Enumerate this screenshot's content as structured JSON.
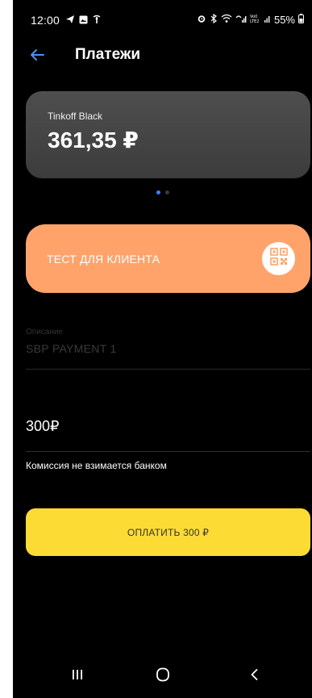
{
  "status_bar": {
    "time": "12:00",
    "battery": "55%",
    "icons": [
      "send-icon",
      "image-icon",
      "signal-relay-icon",
      "alarm-icon",
      "bluetooth-icon",
      "wifi-icon",
      "signal-icon",
      "volte-icon",
      "signal-icon",
      "battery-icon"
    ]
  },
  "header": {
    "title": "Платежи",
    "back_icon": "arrow-left-icon"
  },
  "account": {
    "name": "Tinkoff Black",
    "balance": "361,35 ₽",
    "page_count": 2,
    "active_page": 1
  },
  "recipient": {
    "name": "ТЕСТ ДЛЯ КЛИЕНТА",
    "qr_icon": "qr-code-icon"
  },
  "description": {
    "label": "Описание",
    "value": "SBP PAYMENT 1"
  },
  "amount": {
    "value": "300₽"
  },
  "commission_note": "Комиссия не взимается банком",
  "pay_button": {
    "label": "ОПЛАТИТЬ 300 ₽"
  },
  "nav": {
    "items": [
      "recent-apps-icon",
      "home-icon",
      "back-icon"
    ]
  },
  "colors": {
    "background": "#000000",
    "card": "#444444",
    "recipient_card": "#ffa36b",
    "pay_button": "#fddb35",
    "accent": "#3b82f6"
  }
}
